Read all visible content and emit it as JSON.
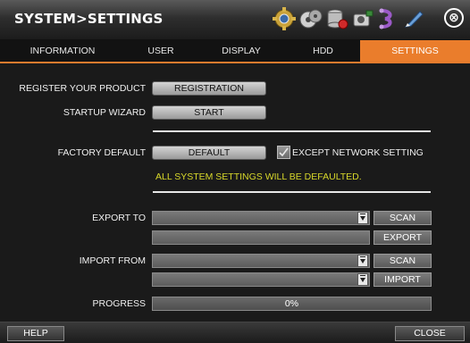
{
  "window": {
    "title": "SYSTEM>SETTINGS"
  },
  "toolbar_icons": [
    "gear-icon",
    "tape-reel-icon",
    "database-icon",
    "camera-icon",
    "network-icon",
    "pen-icon"
  ],
  "close_glyph": "⊗",
  "tabs": [
    {
      "label": "INFORMATION",
      "active": false
    },
    {
      "label": "USER",
      "active": false
    },
    {
      "label": "DISPLAY",
      "active": false
    },
    {
      "label": "HDD",
      "active": false
    },
    {
      "label": "SETTINGS",
      "active": true
    }
  ],
  "register": {
    "label": "REGISTER YOUR PRODUCT",
    "button": "REGISTRATION"
  },
  "wizard": {
    "label": "STARTUP WIZARD",
    "button": "START"
  },
  "factory": {
    "label": "FACTORY DEFAULT",
    "button": "DEFAULT",
    "checkbox_label": "EXCEPT NETWORK SETTING",
    "checkbox_checked": true,
    "warning": "ALL SYSTEM SETTINGS WILL BE DEFAULTED."
  },
  "export": {
    "label": "EXPORT TO",
    "device_value": "",
    "path_value": "",
    "scan_button": "SCAN",
    "action_button": "EXPORT"
  },
  "import": {
    "label": "IMPORT FROM",
    "device_value": "",
    "path_value": "",
    "scan_button": "SCAN",
    "action_button": "IMPORT"
  },
  "progress": {
    "label": "PROGRESS",
    "text": "0%",
    "value": 0
  },
  "footer": {
    "help": "HELP",
    "close": "CLOSE"
  },
  "colors": {
    "accent": "#ea7d2c",
    "warning": "#d9d92a"
  }
}
